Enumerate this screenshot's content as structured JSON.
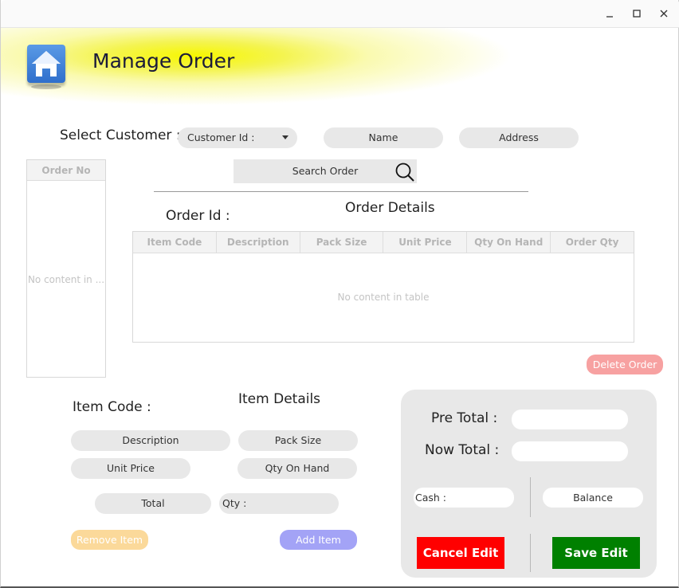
{
  "window": {
    "minimize_icon": "minimize-icon",
    "maximize_icon": "maximize-icon",
    "close_icon": "close-icon"
  },
  "header": {
    "title": "Manage Order",
    "icon": "home-icon",
    "accent": "#f7f700"
  },
  "customer": {
    "label": "Select Customer :",
    "id_select": "Customer Id :",
    "name": "Name",
    "address": "Address"
  },
  "search": {
    "label": "Search Order",
    "icon": "search-icon"
  },
  "order_list": {
    "header": "Order No",
    "empty": "No content in ..."
  },
  "order": {
    "id_label": "Order Id :",
    "details_title": "Order Details"
  },
  "table": {
    "columns": [
      "Item Code",
      "Description",
      "Pack Size",
      "Unit Price",
      "Qty On Hand",
      "Order Qty"
    ],
    "empty": "No content in table"
  },
  "actions": {
    "delete_order": "Delete Order",
    "remove_item": "Remove Item",
    "add_item": "Add Item",
    "cancel_edit": "Cancel Edit",
    "save_edit": "Save Edit"
  },
  "item": {
    "code_label": "Item Code :",
    "details_title": "Item Details",
    "description": "Description",
    "pack_size": "Pack Size",
    "unit_price": "Unit Price",
    "qty_on_hand": "Qty On Hand",
    "total": "Total",
    "qty": "Qty :"
  },
  "totals": {
    "pre_total": "Pre Total :",
    "now_total": "Now Total :",
    "cash": "Cash :",
    "balance": "Balance"
  },
  "colors": {
    "delete": "#f7a1a1",
    "remove": "#fbd99a",
    "add": "#a3a3f6",
    "cancel": "#ff0000",
    "save": "#008000"
  }
}
